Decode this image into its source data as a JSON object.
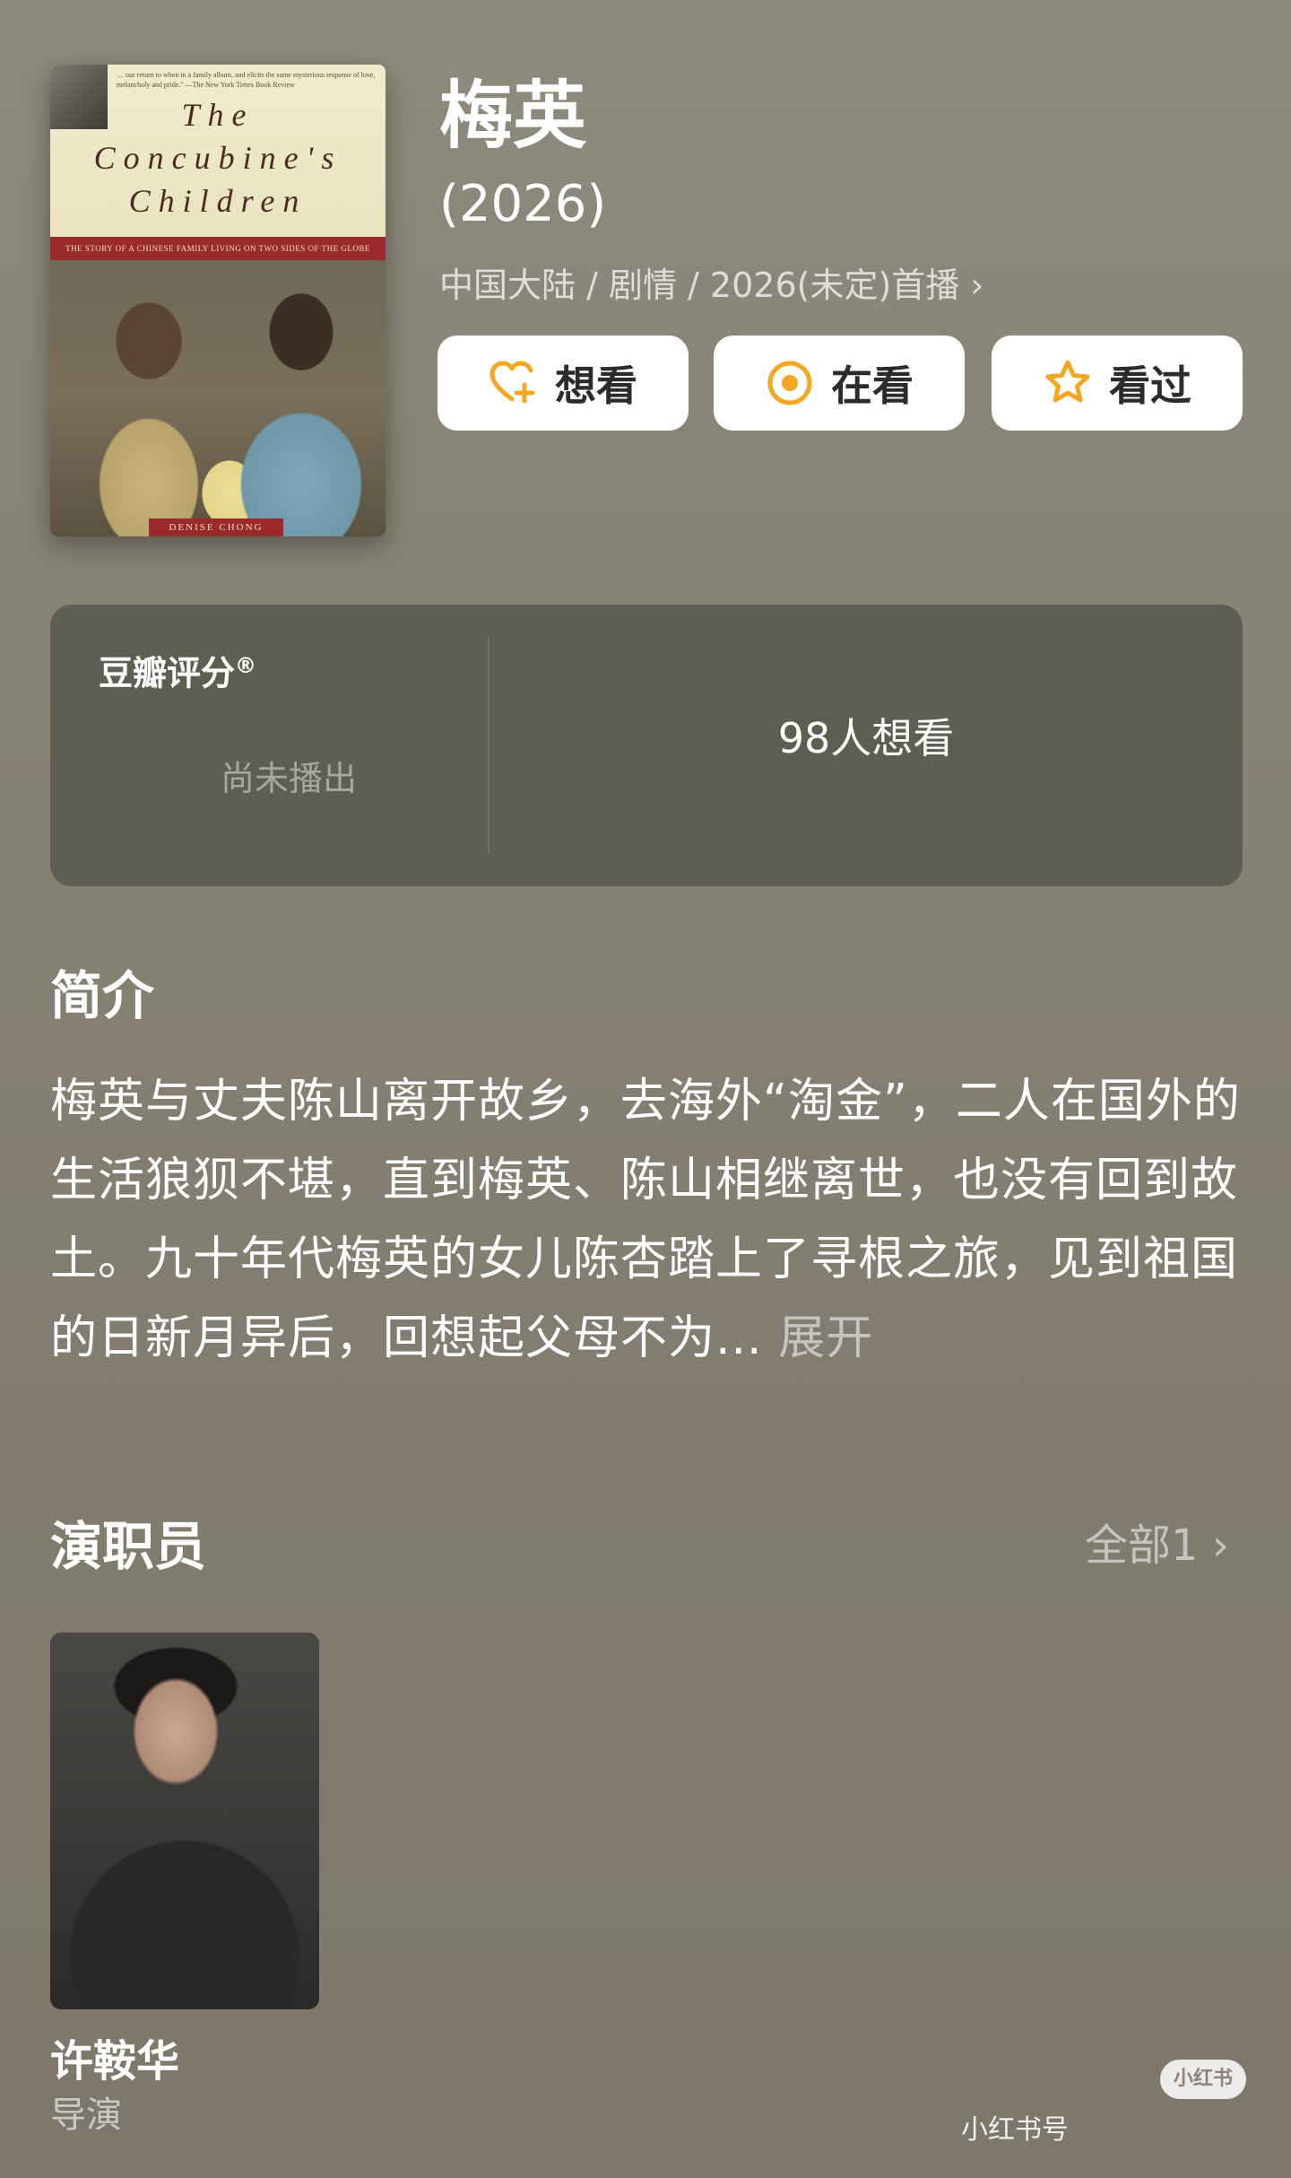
{
  "poster": {
    "blurb": "… our return to when in a family album, and elicits the same mysterious response of love, melancholy and pride.\" —The New York Times Book Review",
    "title_line1": "The",
    "title_line2": "Concubine's",
    "title_line3": "Children",
    "band_text": "THE STORY OF A CHINESE FAMILY LIVING ON TWO SIDES OF THE GLOBE",
    "author": "DENISE CHONG"
  },
  "header": {
    "title": "梅英",
    "year": "(2026)",
    "meta": "中国大陆 / 剧情 / 2026(未定)首播",
    "meta_chevron": "›"
  },
  "actions": {
    "want": "想看",
    "watching": "在看",
    "watched": "看过",
    "accent_color": "#f5a623"
  },
  "rating": {
    "label": "豆瓣评分",
    "label_mark": "®",
    "status": "尚未播出",
    "want_count": "98人想看"
  },
  "synopsis": {
    "heading": "简介",
    "text": "梅英与丈夫陈山离开故乡，去海外“淘金”，二人在国外的生活狼狈不堪，直到梅英、陈山相继离世，也没有回到故土。九十年代梅英的女儿陈杏踏上了寻根之旅，见到祖国的日新月异后，回想起父母不为...",
    "more": " 展开"
  },
  "cast": {
    "heading": "演职员",
    "all_link": "全部1",
    "all_chevron": "›",
    "members": [
      {
        "name": "许鞍华",
        "role": "导演"
      }
    ]
  },
  "watermark": {
    "badge": "小红书",
    "text": "小红书号"
  }
}
